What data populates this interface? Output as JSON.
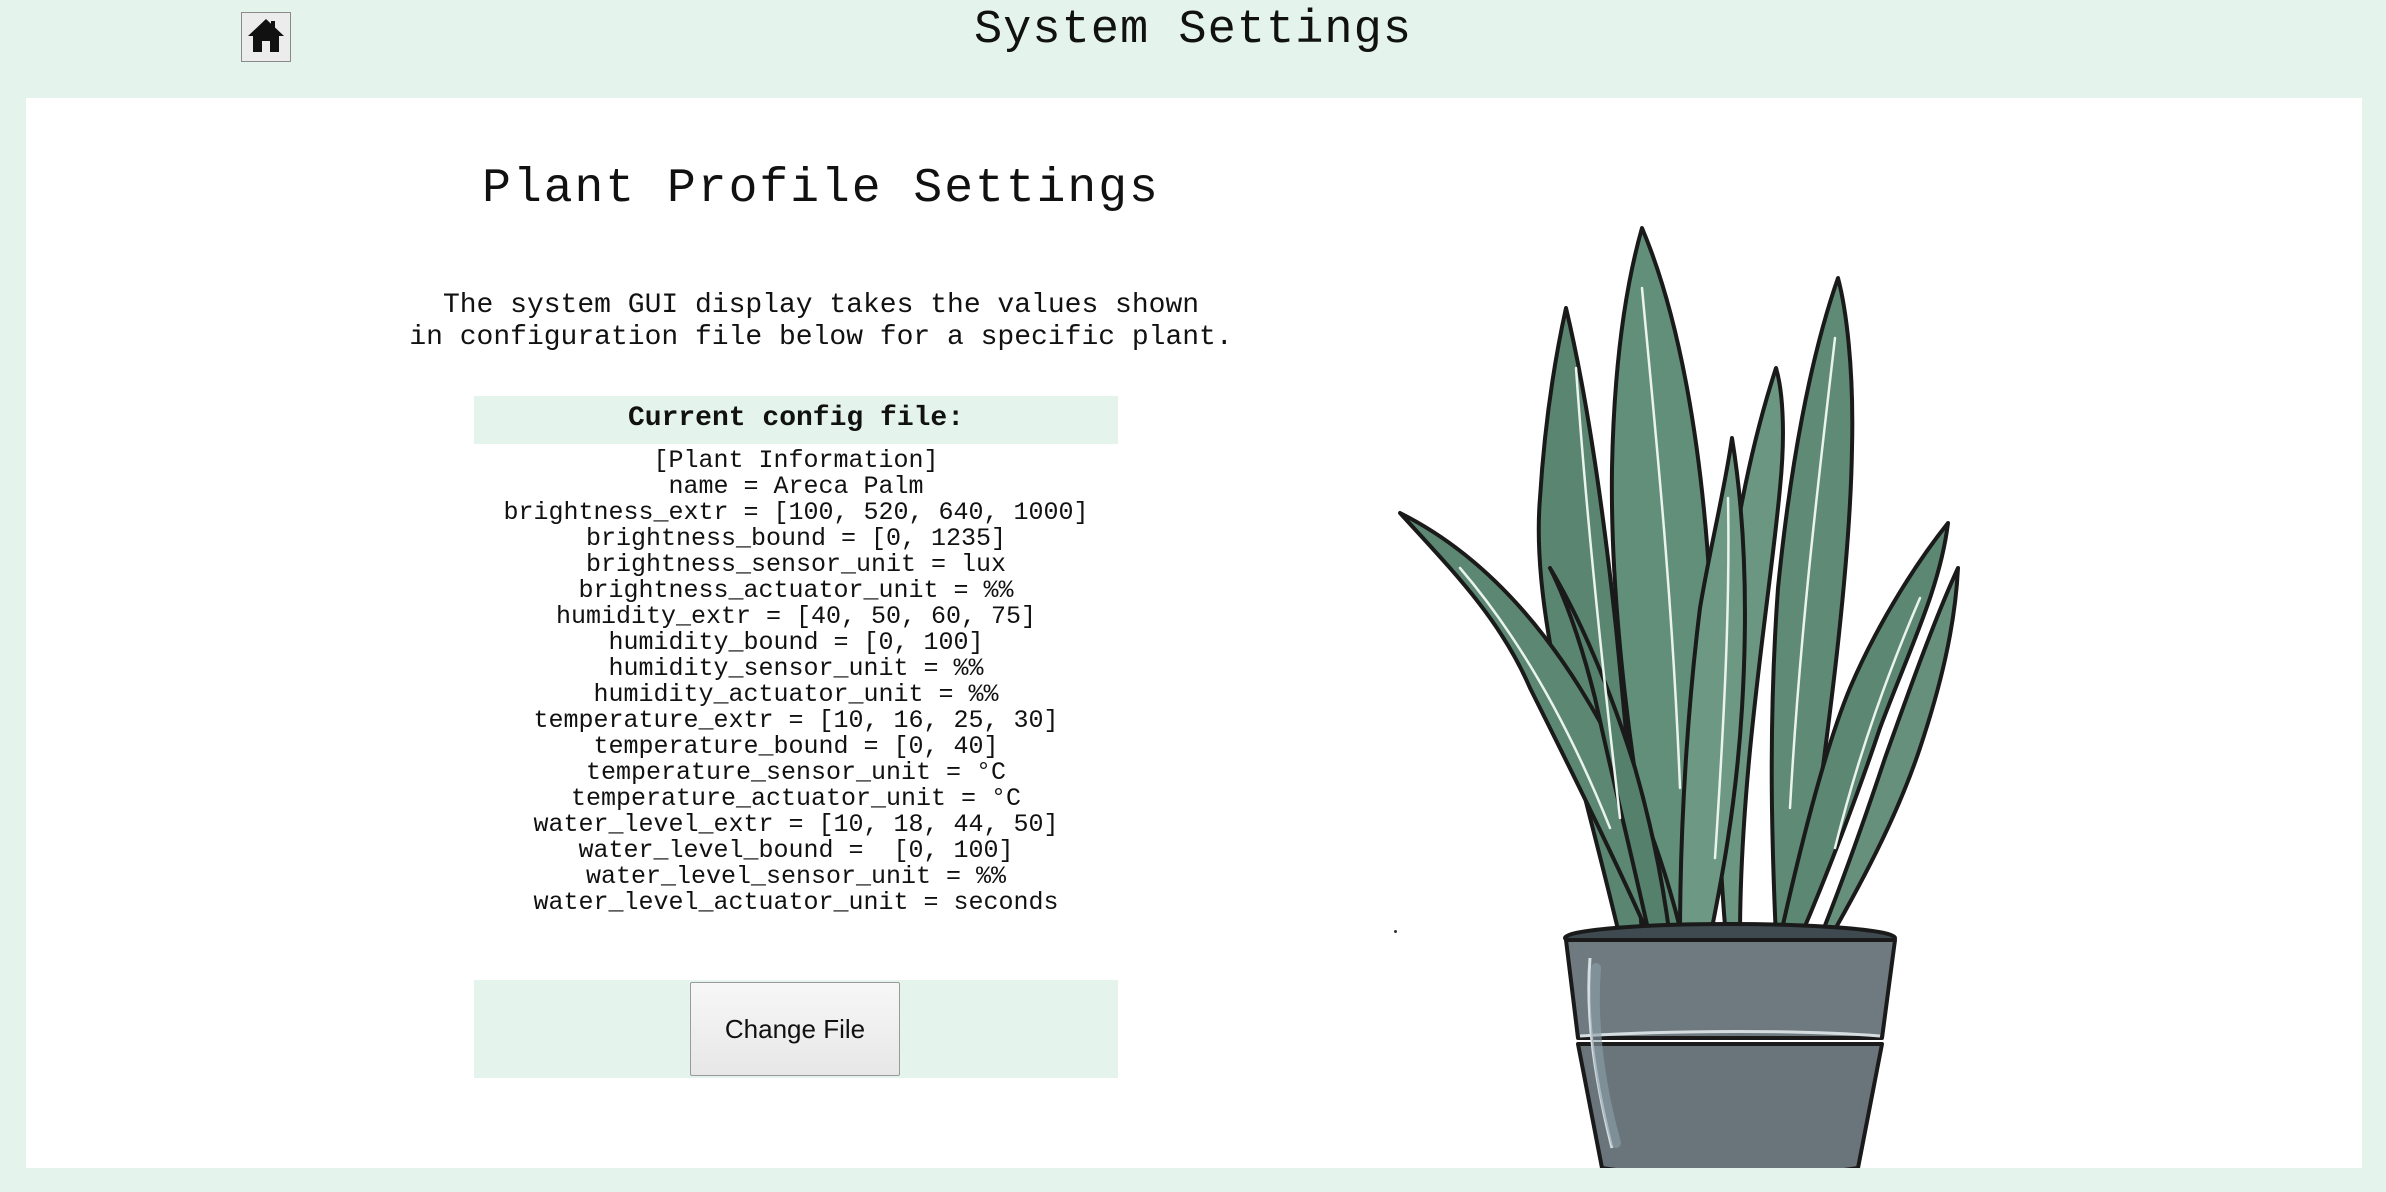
{
  "header": {
    "title": "System Settings",
    "home_icon": "home-icon"
  },
  "main": {
    "section_title": "Plant Profile Settings",
    "description": "The system GUI display takes the values shown\nin configuration file below for a specific plant.",
    "config_header": "Current config file:",
    "config_lines": [
      "[Plant Information]",
      "name = Areca Palm",
      "brightness_extr = [100, 520, 640, 1000]",
      "brightness_bound = [0, 1235]",
      "brightness_sensor_unit = lux",
      "brightness_actuator_unit = %%",
      "humidity_extr = [40, 50, 60, 75]",
      "humidity_bound = [0, 100]",
      "humidity_sensor_unit = %%",
      "humidity_actuator_unit = %%",
      "temperature_extr = [10, 16, 25, 30]",
      "temperature_bound = [0, 40]",
      "temperature_sensor_unit = °C",
      "temperature_actuator_unit = °C",
      "water_level_extr = [10, 18, 44, 50]",
      "water_level_bound =  [0, 100]",
      "water_level_sensor_unit = %%",
      "water_level_actuator_unit = seconds"
    ],
    "change_button_label": "Change File"
  },
  "illustration": {
    "icon": "snake-plant-illustration",
    "colors": {
      "leaf": "#5f8a75",
      "pot": "#6f7a80",
      "outline": "#1a1a1a",
      "background": "#e4f4ec"
    }
  }
}
